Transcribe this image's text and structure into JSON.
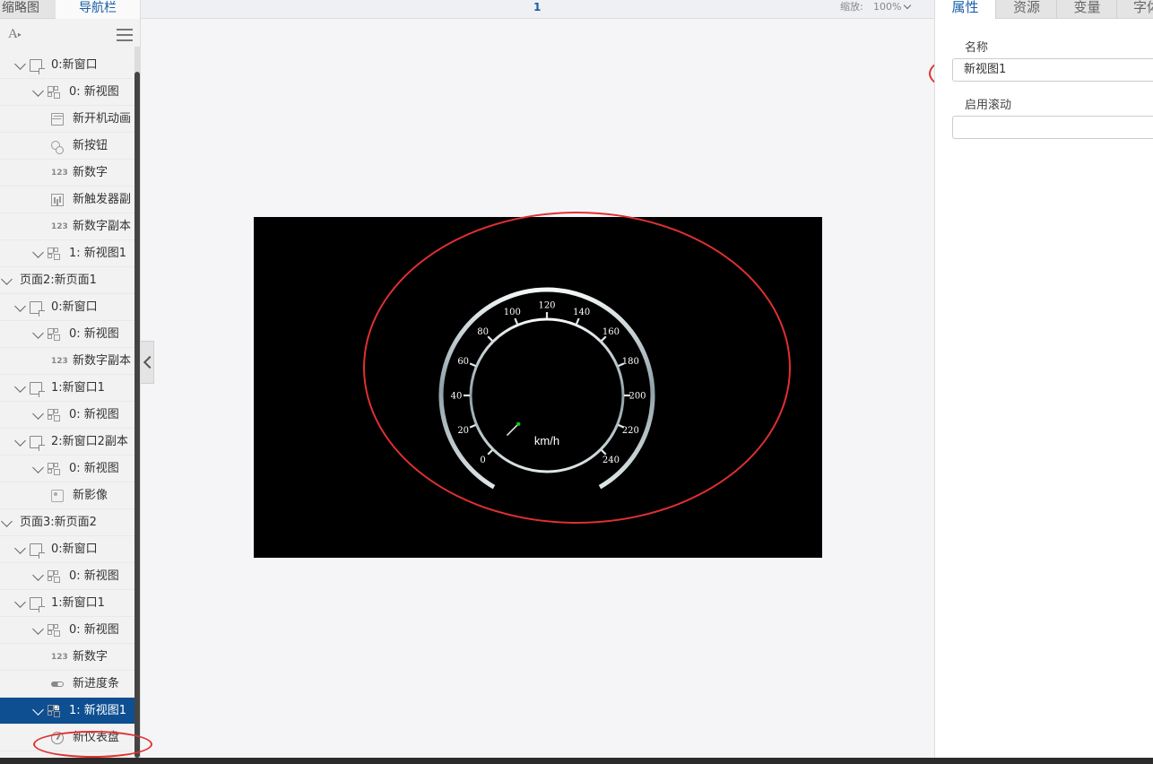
{
  "left_tabs": [
    "缩略图",
    "导航栏"
  ],
  "tree": [
    {
      "label": "0:新窗口",
      "icon": "window-icon",
      "level": 1,
      "chevron": true
    },
    {
      "label": "0: 新视图",
      "icon": "view-icon",
      "level": 2,
      "chevron": true
    },
    {
      "label": "新开机动画",
      "icon": "animation-icon",
      "level": 3,
      "chevron": false
    },
    {
      "label": "新按钮",
      "icon": "button-icon",
      "level": 3,
      "chevron": false
    },
    {
      "label": "新数字",
      "icon": "number-icon",
      "level": 3,
      "chevron": false
    },
    {
      "label": "新触发器副",
      "icon": "trigger-icon",
      "level": 3,
      "chevron": false
    },
    {
      "label": "新数字副本",
      "icon": "number-icon",
      "level": 3,
      "chevron": false
    },
    {
      "label": "1: 新视图1",
      "icon": "view-icon",
      "level": 2,
      "chevron": true
    },
    {
      "label": "页面2:新页面1",
      "icon": "",
      "level": 0,
      "chevron": true
    },
    {
      "label": "0:新窗口",
      "icon": "window-icon",
      "level": 1,
      "chevron": true
    },
    {
      "label": "0: 新视图",
      "icon": "view-icon",
      "level": 2,
      "chevron": true
    },
    {
      "label": "新数字副本",
      "icon": "number-icon",
      "level": 3,
      "chevron": false
    },
    {
      "label": "1:新窗口1",
      "icon": "window-icon",
      "level": 1,
      "chevron": true
    },
    {
      "label": "0: 新视图",
      "icon": "view-icon",
      "level": 2,
      "chevron": true
    },
    {
      "label": "2:新窗口2副本",
      "icon": "window-icon",
      "level": 1,
      "chevron": true
    },
    {
      "label": "0: 新视图",
      "icon": "view-icon",
      "level": 2,
      "chevron": true
    },
    {
      "label": "新影像",
      "icon": "image-icon",
      "level": 3,
      "chevron": false
    },
    {
      "label": "页面3:新页面2",
      "icon": "",
      "level": 0,
      "chevron": true
    },
    {
      "label": "0:新窗口",
      "icon": "window-icon",
      "level": 1,
      "chevron": true
    },
    {
      "label": "0: 新视图",
      "icon": "view-icon",
      "level": 2,
      "chevron": true
    },
    {
      "label": "1:新窗口1",
      "icon": "window-icon",
      "level": 1,
      "chevron": true
    },
    {
      "label": "0: 新视图",
      "icon": "view-icon",
      "level": 2,
      "chevron": true
    },
    {
      "label": "新数字",
      "icon": "number-icon",
      "level": 3,
      "chevron": false
    },
    {
      "label": "新进度条",
      "icon": "progress-icon",
      "level": 3,
      "chevron": false
    },
    {
      "label": "1: 新视图1",
      "icon": "view-icon",
      "level": 2,
      "chevron": true,
      "selected": true
    },
    {
      "label": "新仪表盘",
      "icon": "gauge-icon",
      "level": 3,
      "chevron": false
    }
  ],
  "number_icon_text": "123",
  "topbar": {
    "page_number": "1",
    "zoom_label": "缩放:",
    "zoom_value": "100%"
  },
  "gauge": {
    "ticks": [
      "0",
      "20",
      "40",
      "60",
      "80",
      "100",
      "120",
      "140",
      "160",
      "180",
      "200",
      "220",
      "240"
    ],
    "unit": "km/h",
    "value": 0,
    "needle_color": "#19c419"
  },
  "right_tabs": [
    "属性",
    "资源",
    "变量",
    "字体"
  ],
  "properties": {
    "name_label": "名称",
    "name_value": "新视图1",
    "scroll_label": "启用滚动",
    "scroll_value": ""
  },
  "colors": {
    "selected": "#0d4f91",
    "accent": "#1a5fa8",
    "annotation": "#e03030"
  }
}
